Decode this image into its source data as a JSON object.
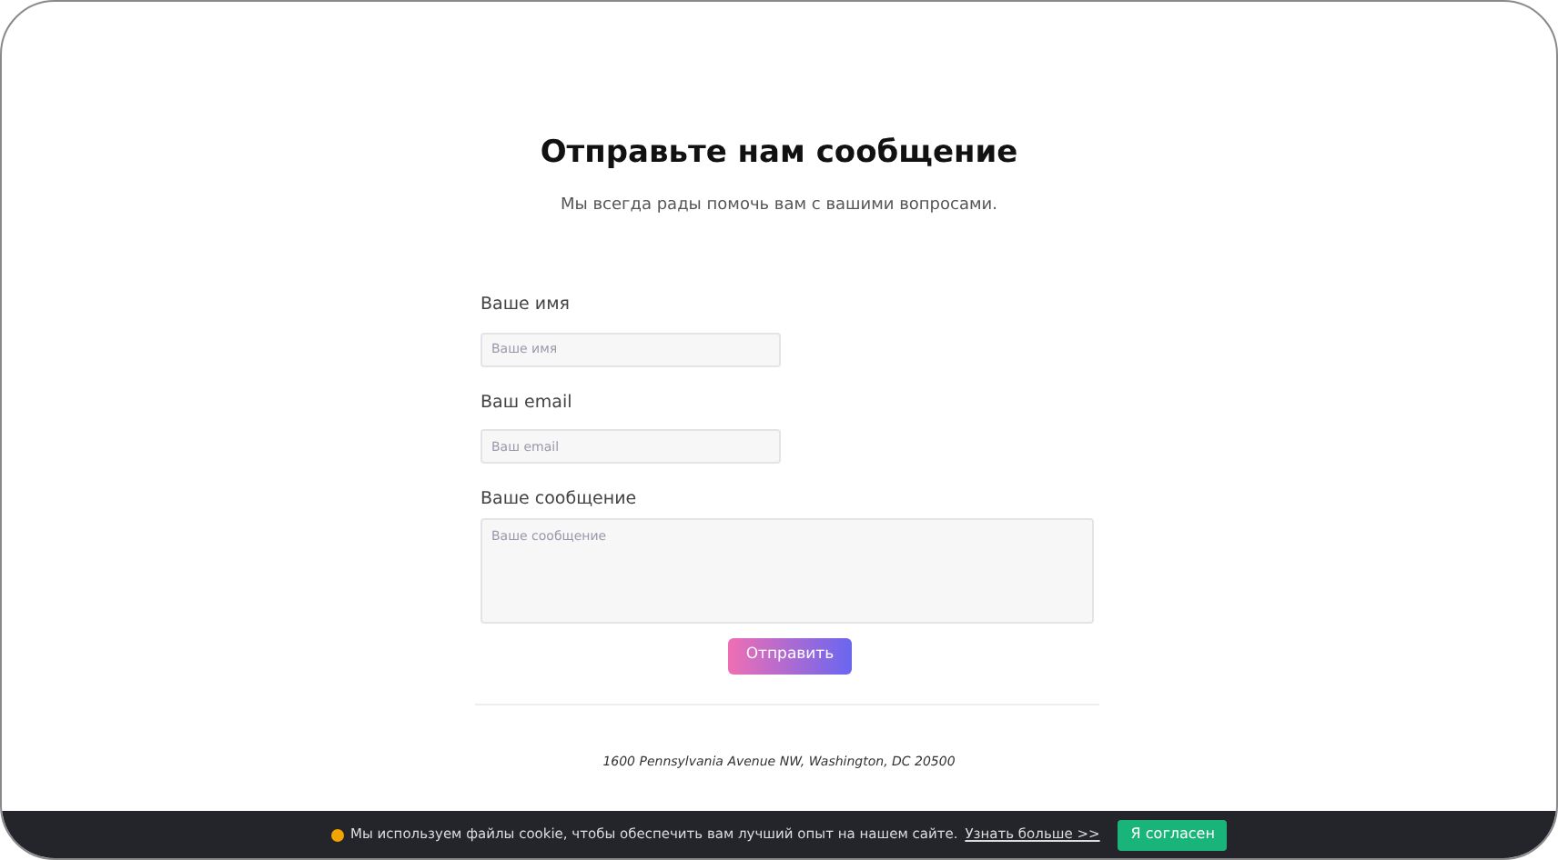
{
  "title": "Отправьте нам сообщение",
  "subtitle": "Мы всегда рады помочь вам с вашими вопросами.",
  "form": {
    "fields": [
      {
        "kind": "input",
        "label": "Ваше имя",
        "placeholder": "Ваше имя"
      },
      {
        "kind": "input",
        "label": "Ваш email",
        "placeholder": "Ваш email"
      },
      {
        "kind": "textarea",
        "label": "Ваше сообщение",
        "placeholder": "Ваше сообщение"
      }
    ],
    "submit": "Отправить"
  },
  "address": "1600 Pennsylvania Avenue NW, Washington, DC 20500",
  "cookie_bar": {
    "text": "Мы используем файлы cookie, чтобы обеспечить вам лучший опыт на нашем сайте.",
    "link": "Узнать больше >>",
    "button": "Я согласен"
  }
}
